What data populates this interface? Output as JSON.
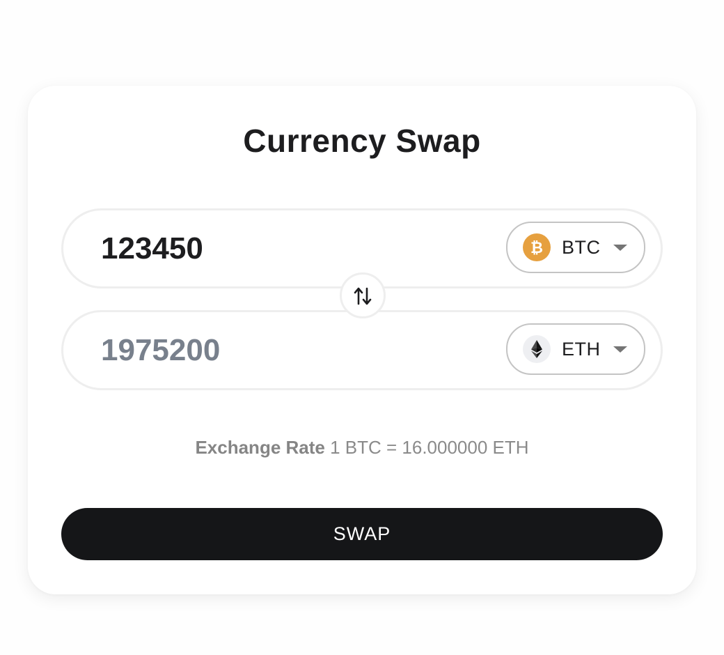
{
  "card": {
    "title": "Currency Swap"
  },
  "from": {
    "amount": "123450",
    "currency": {
      "symbol": "BTC",
      "icon": "bitcoin-icon",
      "color": "#e6a03f"
    }
  },
  "to": {
    "amount": "1975200",
    "currency": {
      "symbol": "ETH",
      "icon": "ethereum-icon",
      "color": "#eeeff2"
    }
  },
  "swap_toggle": {
    "icon": "swap-arrows-icon"
  },
  "rate": {
    "label": "Exchange Rate",
    "value": "1 BTC = 16.000000 ETH"
  },
  "action": {
    "label": "SWAP",
    "color": "#151618"
  },
  "colors": {
    "amount_from": "#1d1d1f",
    "amount_to": "#78808c",
    "muted_text": "#8a8a8a"
  }
}
